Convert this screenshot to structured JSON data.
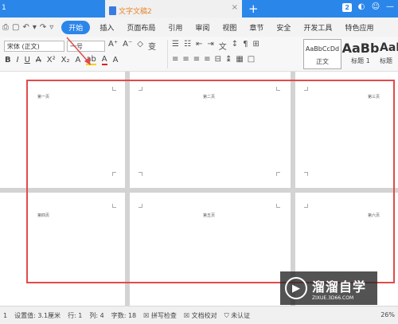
{
  "titlebar": {
    "prev_tab": "1",
    "active_tab": "文字文稿2",
    "close": "×",
    "new_tab": "+",
    "badge": "2"
  },
  "menu": {
    "start": "开始",
    "items": [
      "插入",
      "页面布局",
      "引用",
      "审阅",
      "视图",
      "章节",
      "安全",
      "开发工具",
      "特色应用"
    ]
  },
  "ribbon": {
    "font_name": "宋体 (正文)",
    "font_size": "一号",
    "bold": "B",
    "italic": "I",
    "underline": "U",
    "styles": [
      {
        "preview": "AaBbCcDd",
        "name": "正文"
      },
      {
        "preview": "AaBb",
        "name": "标题 1"
      },
      {
        "preview": "AaE",
        "name": "标题"
      }
    ]
  },
  "document": {
    "pages": [
      "第一页",
      "第二页",
      "第三页",
      "第四页",
      "第五页",
      "第六页"
    ]
  },
  "watermark": {
    "title": "溜溜自学",
    "url": "ZIXUE.3D66.COM"
  },
  "status": {
    "page": "1",
    "setting": "设置值: 3.1厘米",
    "row": "行: 1",
    "col": "列: 4",
    "words": "字数: 18",
    "spell": "拼写检查",
    "compare": "文档校对",
    "auth": "未认证",
    "zoom": "26%"
  },
  "colors": {
    "accent": "#2b86ea",
    "frame": "#e34a4a"
  }
}
